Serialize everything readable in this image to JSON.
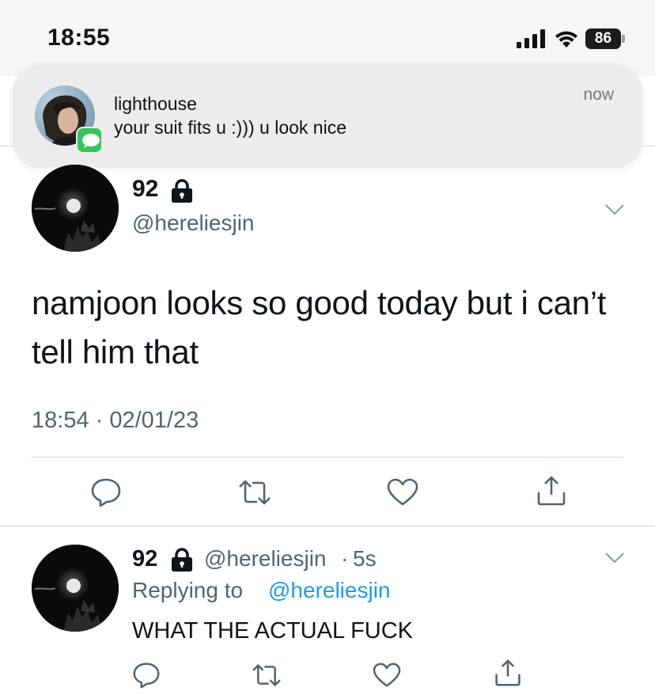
{
  "status_bar": {
    "time": "18:55",
    "battery": "86"
  },
  "notification": {
    "sender": "lighthouse",
    "message": "your suit fits u :))) u look nice",
    "time": "now",
    "app_icon": "messages-icon"
  },
  "tweet": {
    "name": "92",
    "handle": "@hereliesjin",
    "text": "namjoon looks so good today but i can’t tell him that",
    "timestamp": "18:54 · 02/01/23",
    "actions": [
      "reply-icon",
      "retweet-icon",
      "like-icon",
      "share-icon"
    ]
  },
  "reply": {
    "name": "92",
    "handle": "@hereliesjin",
    "separator": "·",
    "age": "5s",
    "replying_prefix": "Replying to",
    "replying_to": "@hereliesjin",
    "text": "WHAT THE ACTUAL FUCK",
    "actions": [
      "reply-icon",
      "retweet-icon",
      "like-icon",
      "share-icon"
    ]
  },
  "colors": {
    "accent": "#1d9bf0",
    "secondary_text": "#536471",
    "messages_green": "#34c759"
  }
}
